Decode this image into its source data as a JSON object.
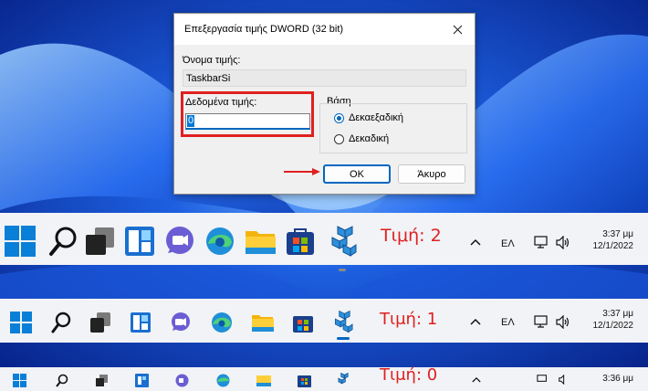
{
  "dialog": {
    "title": "Επεξεργασία τιμής DWORD (32 bit)",
    "value_name_label": "Όνομα τιμής:",
    "value_name": "TaskbarSi",
    "value_data_label": "Δεδομένα τιμής:",
    "value_data": "0",
    "base_label": "Βάση",
    "base_options": [
      "Δεκαεξαδική",
      "Δεκαδική"
    ],
    "base_selected": "Δεκαεξαδική",
    "ok_label": "OK",
    "cancel_label": "Άκυρο"
  },
  "taskbars": [
    {
      "size_label": "Τιμή: 2",
      "language": "ΕΛ",
      "time": "3:37 μμ",
      "date": "12/1/2022"
    },
    {
      "size_label": "Τιμή: 1",
      "language": "ΕΛ",
      "time": "3:37 μμ",
      "date": "12/1/2022"
    },
    {
      "size_label": "Τιμή: 0",
      "time": "3:36 μμ"
    }
  ],
  "taskbar_icons": [
    "windows-start-icon",
    "search-icon",
    "task-view-icon",
    "widgets-icon",
    "teams-chat-icon",
    "edge-icon",
    "file-explorer-icon",
    "store-icon",
    "regedit-icon"
  ],
  "colors": {
    "highlight": "#e02020",
    "accent": "#0067c0",
    "taskbar": "#f1f3f6"
  }
}
